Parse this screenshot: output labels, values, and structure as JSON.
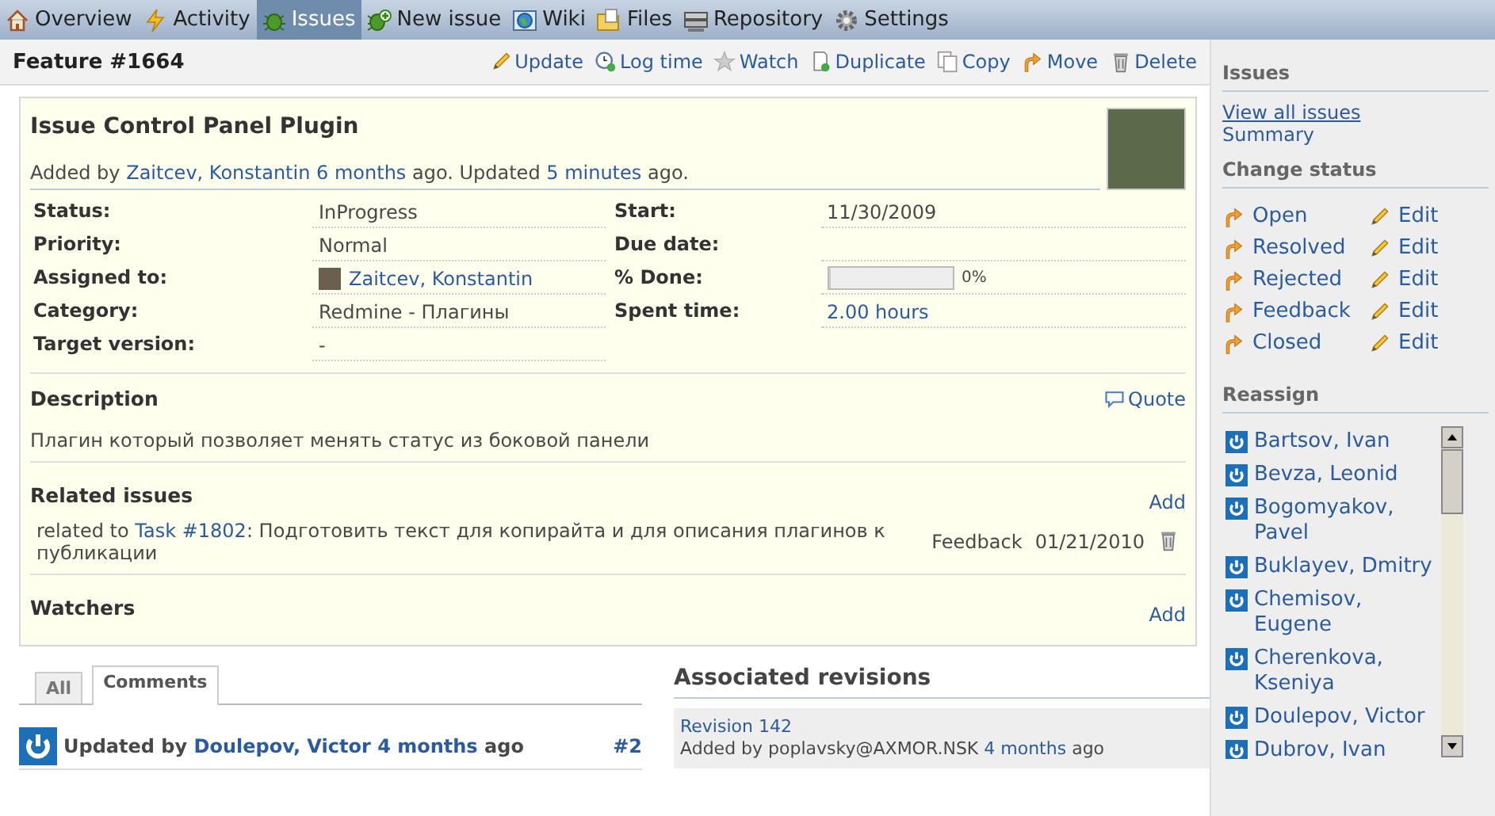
{
  "main_menu": [
    {
      "label": "Overview",
      "selected": false
    },
    {
      "label": "Activity",
      "selected": false
    },
    {
      "label": "Issues",
      "selected": true
    },
    {
      "label": "New issue",
      "selected": false
    },
    {
      "label": "Wiki",
      "selected": false
    },
    {
      "label": "Files",
      "selected": false
    },
    {
      "label": "Repository",
      "selected": false
    },
    {
      "label": "Settings",
      "selected": false
    }
  ],
  "issue": {
    "heading": "Feature #1664",
    "actions": [
      "Update",
      "Log time",
      "Watch",
      "Duplicate",
      "Copy",
      "Move",
      "Delete"
    ],
    "subject": "Issue Control Panel Plugin",
    "byline": {
      "prefix": "Added by ",
      "author": "Zaitcev, Konstantin",
      "added": "6 months",
      "middle": " ago. Updated ",
      "updated": "5 minutes",
      "suffix": " ago."
    },
    "attributes_left": [
      {
        "label": "Status:",
        "value": "InProgress"
      },
      {
        "label": "Priority:",
        "value": "Normal"
      },
      {
        "label": "Assigned to:",
        "value": "Zaitcev, Konstantin",
        "kind": "user"
      },
      {
        "label": "Category:",
        "value": "Redmine - Плагины"
      },
      {
        "label": "Target version:",
        "value": "-"
      }
    ],
    "attributes_right": [
      {
        "label": "Start:",
        "value": "11/30/2009"
      },
      {
        "label": "Due date:"
      },
      {
        "label": "% Done:",
        "value": "0%",
        "kind": "progress",
        "level": 0
      },
      {
        "label": "Spent time:",
        "value": "2.00 hours",
        "kind": "link"
      }
    ],
    "description": {
      "title": "Description",
      "quote": "Quote",
      "text": "Плагин который позволяет менять статус из боковой панели"
    },
    "related": {
      "title": "Related issues",
      "add": "Add",
      "items": [
        {
          "prefix": "related to ",
          "link": "Task #1802",
          "text": ": Подготовить текст для копирайта и для описания плагинов к публикации",
          "status": "Feedback",
          "date": "01/21/2010"
        }
      ]
    },
    "watchers": {
      "title": "Watchers",
      "add": "Add"
    }
  },
  "history_tabs": [
    {
      "label": "All",
      "selected": false
    },
    {
      "label": "Comments",
      "selected": true
    }
  ],
  "journal": {
    "prefix": "Updated by ",
    "author": "Doulepov, Victor",
    "time": "4 months",
    "suffix": " ago",
    "number": "#2"
  },
  "revisions": {
    "title": "Associated revisions",
    "items": [
      {
        "revision": "Revision 142",
        "prefix": "Added by poplavsky@AXMOR.NSK ",
        "time": "4 months",
        "suffix": " ago"
      }
    ]
  },
  "sidebar": {
    "issues_title": "Issues",
    "links": [
      "View all issues",
      "Summary"
    ],
    "status_title": "Change status",
    "statuses": [
      {
        "label": "Open",
        "edit": "Edit"
      },
      {
        "label": "Resolved",
        "edit": "Edit"
      },
      {
        "label": "Rejected",
        "edit": "Edit"
      },
      {
        "label": "Feedback",
        "edit": "Edit"
      },
      {
        "label": "Closed",
        "edit": "Edit"
      }
    ],
    "reassign_title": "Reassign",
    "people": [
      "Bartsov, Ivan",
      "Bevza, Leonid",
      "Bogomyakov, Pavel",
      "Buklayev, Dmitry",
      "Chemisov, Eugene",
      "Cherenkova, Kseniya",
      "Doulepov, Victor",
      "Dubrov, Ivan"
    ]
  }
}
